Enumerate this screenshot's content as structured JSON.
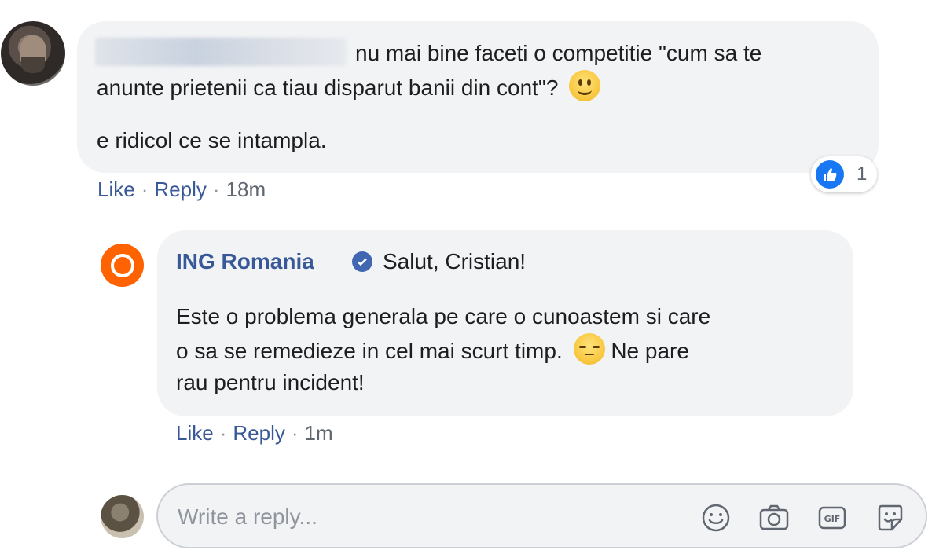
{
  "comment": {
    "author_avatar": "user-avatar",
    "line1": "nu mai bine faceti o competitie \"cum sa te",
    "line2": "anunte prietenii ca tiau disparut banii din cont\"?",
    "line3": "e ridicol ce se intampla.",
    "reaction_count": "1",
    "actions": {
      "like": "Like",
      "reply": "Reply",
      "time": "18m"
    }
  },
  "reply": {
    "author": "ING Romania",
    "greeting": "Salut, Cristian!",
    "line1": "Este o problema generala pe care o cunoastem si care",
    "line2": "o sa se remedieze in cel mai scurt timp.",
    "line2_end": "Ne pare",
    "line3": "rau pentru incident!",
    "actions": {
      "like": "Like",
      "reply": "Reply",
      "time": "1m"
    }
  },
  "composer": {
    "placeholder": "Write a reply...",
    "tools": [
      "emoji-icon",
      "camera-icon",
      "gif-icon",
      "sticker-icon"
    ]
  },
  "colors": {
    "link": "#385898",
    "bubble": "#f2f3f5",
    "like_blue": "#1877f2",
    "ing_orange": "#ff6200"
  }
}
